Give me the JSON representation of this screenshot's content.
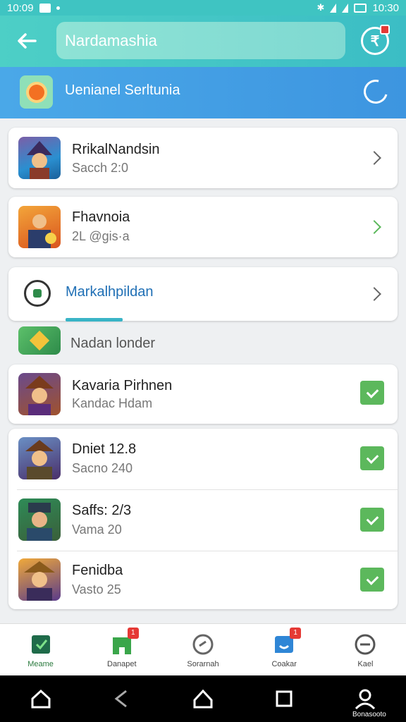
{
  "status_bar": {
    "time_left": "10:09",
    "time_right": "10:30"
  },
  "app_bar": {
    "search_value": "Nardamashia"
  },
  "banner": {
    "label": "Uenianel Serltunia"
  },
  "rows_top": [
    {
      "title": "RrikalNandsin",
      "subtitle": "Sacch 2:0",
      "action": "chevron"
    },
    {
      "title": "Fhavnoia",
      "subtitle": "2L @gis·a",
      "action": "chevron-green"
    }
  ],
  "menu": {
    "label": "Markalhpildan"
  },
  "section": {
    "label": "Nadan londer"
  },
  "row_single": {
    "title": "Kavaria Pirhnen",
    "subtitle": "Kandac Hdam",
    "action": "check"
  },
  "rows_group": [
    {
      "title": "Dniet 12.8",
      "subtitle": "Sacno 240",
      "action": "check"
    },
    {
      "title": "Saffs: 2/3",
      "subtitle": "Vama 20",
      "action": "check"
    },
    {
      "title": "Fenidba",
      "subtitle": "Vasto 25",
      "action": "check"
    }
  ],
  "bottom_nav": [
    {
      "label": "Meame",
      "icon": "home-doc-icon",
      "active": true
    },
    {
      "label": "Danapet",
      "icon": "store-icon",
      "badge": "1"
    },
    {
      "label": "Sorarnah",
      "icon": "compass-icon"
    },
    {
      "label": "Coakar",
      "icon": "chat-icon",
      "badge": "1"
    },
    {
      "label": "Kael",
      "icon": "profile-icon"
    }
  ],
  "sys_label": "Bonasooto",
  "colors": {
    "accent": "#3fc4c2",
    "banner": "#3d95e0",
    "check": "#5cb85c",
    "link": "#1f6fb5"
  }
}
